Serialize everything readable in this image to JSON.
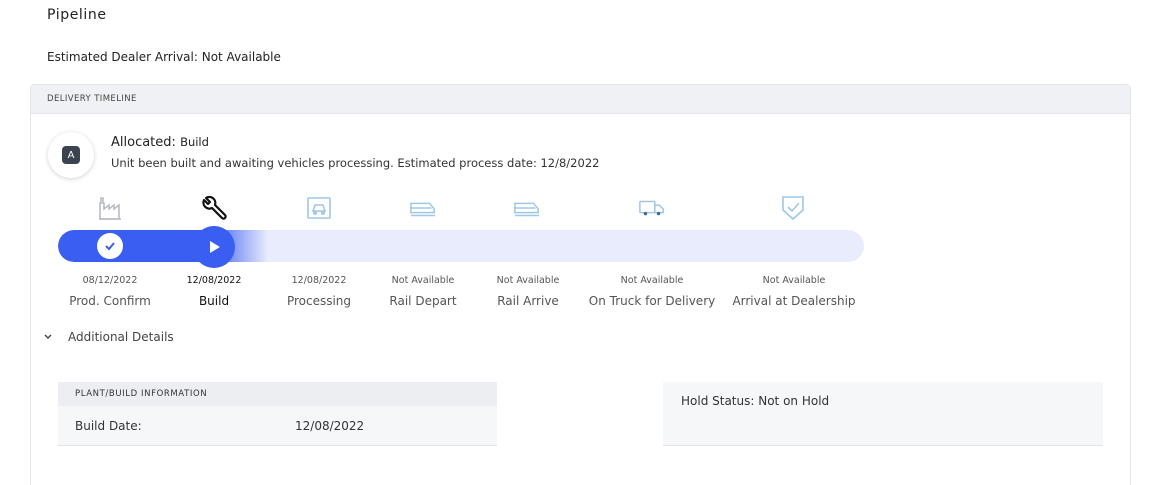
{
  "page": {
    "title": "Pipeline",
    "arrival_label": "Estimated Dealer Arrival: Not Available"
  },
  "timeline": {
    "header": "DELIVERY TIMELINE",
    "status": {
      "badge": "A",
      "label": "Allocated:",
      "value": "Build",
      "description": "Unit been built and awaiting vehicles processing. Estimated process date: 12/8/2022"
    },
    "progress_fraction": 0.26,
    "stages": [
      {
        "icon": "factory-icon",
        "date": "08/12/2022",
        "label": "Prod. Confirm",
        "state": "complete"
      },
      {
        "icon": "wrench-icon",
        "date": "12/08/2022",
        "label": "Build",
        "state": "current"
      },
      {
        "icon": "processing-icon",
        "date": "12/08/2022",
        "label": "Processing",
        "state": "pending"
      },
      {
        "icon": "rail-depart-icon",
        "date": "Not Available",
        "label": "Rail Depart",
        "state": "pending"
      },
      {
        "icon": "rail-arrive-icon",
        "date": "Not Available",
        "label": "Rail Arrive",
        "state": "pending"
      },
      {
        "icon": "truck-icon",
        "date": "Not Available",
        "label": "On Truck for Delivery",
        "state": "pending"
      },
      {
        "icon": "shield-check-icon",
        "date": "Not Available",
        "label": "Arrival at Dealership",
        "state": "pending"
      }
    ],
    "colors": {
      "accent": "#3a5df2",
      "track": "#e9ecfc",
      "icon_pending": "#9fc7e6",
      "icon_done": "#b9bcc2"
    }
  },
  "details": {
    "toggle_label": "Additional Details",
    "plant": {
      "header": "PLANT/BUILD INFORMATION",
      "build_date_label": "Build Date:",
      "build_date_value": "12/08/2022"
    },
    "hold": {
      "text": "Hold Status: Not on Hold"
    }
  }
}
